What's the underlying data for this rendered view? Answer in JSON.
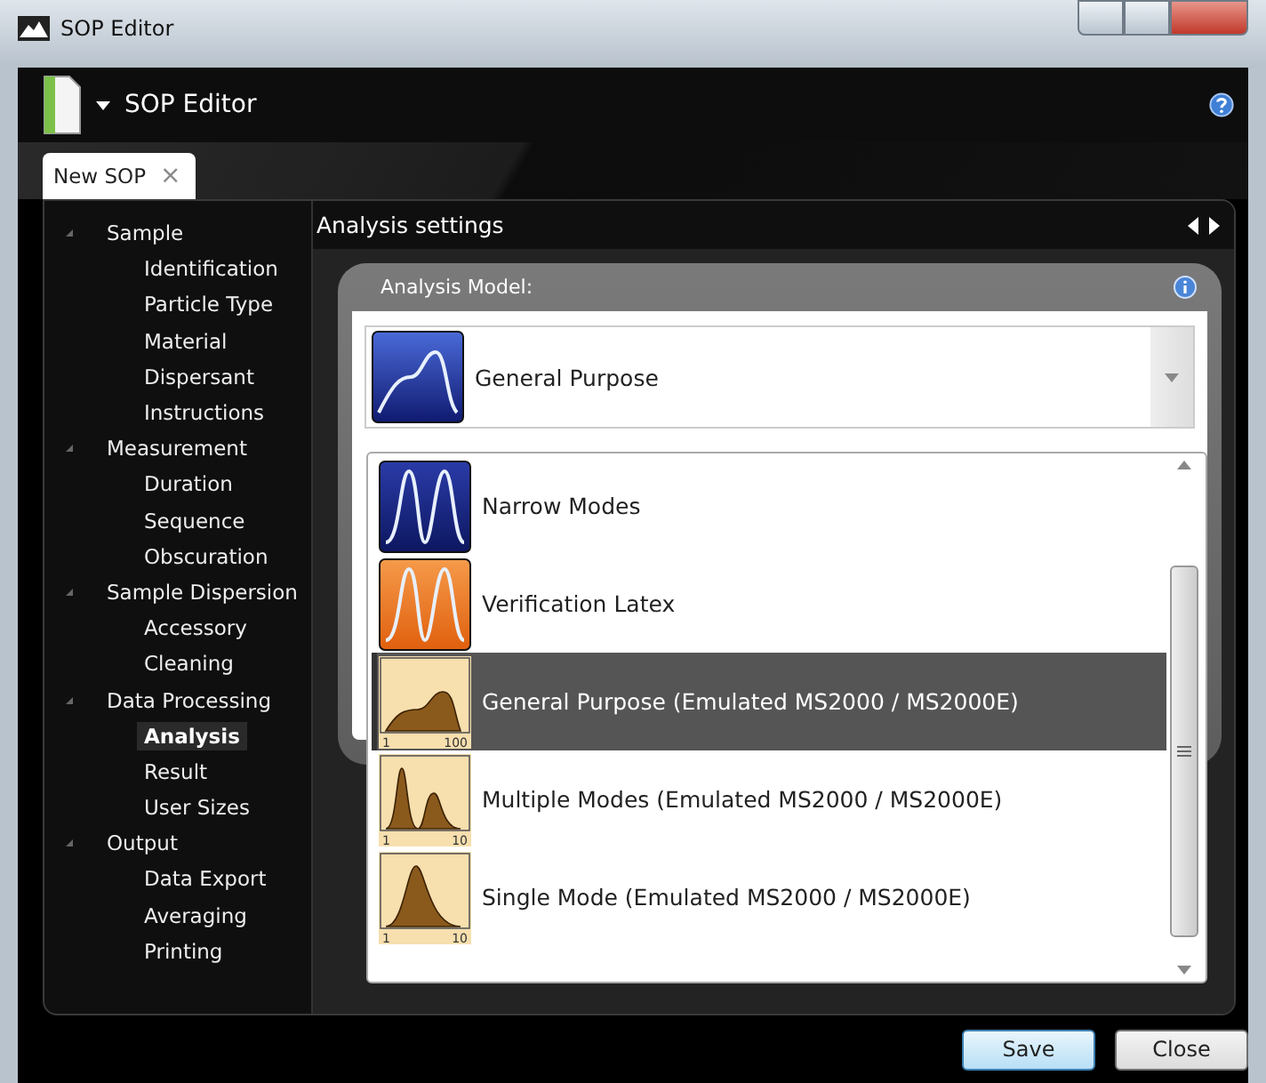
{
  "window": {
    "title": "SOP Editor"
  },
  "header": {
    "title": "SOP Editor"
  },
  "tabs": [
    {
      "label": "New SOP",
      "close": "×",
      "selected": true
    }
  ],
  "tree": [
    {
      "label": "Sample",
      "expanded": true,
      "children": [
        {
          "label": "Identification",
          "selected": false
        },
        {
          "label": "Particle Type",
          "selected": false
        },
        {
          "label": "Material",
          "selected": false
        },
        {
          "label": "Dispersant",
          "selected": false
        },
        {
          "label": "Instructions",
          "selected": false
        }
      ]
    },
    {
      "label": "Measurement",
      "expanded": true,
      "children": [
        {
          "label": "Duration",
          "selected": false
        },
        {
          "label": "Sequence",
          "selected": false
        },
        {
          "label": "Obscuration",
          "selected": false
        }
      ]
    },
    {
      "label": "Sample Dispersion",
      "expanded": true,
      "children": [
        {
          "label": "Accessory",
          "selected": false
        },
        {
          "label": "Cleaning",
          "selected": false
        }
      ]
    },
    {
      "label": "Data Processing",
      "expanded": true,
      "children": [
        {
          "label": "Analysis",
          "selected": true
        },
        {
          "label": "Result",
          "selected": false
        },
        {
          "label": "User Sizes",
          "selected": false
        }
      ]
    },
    {
      "label": "Output",
      "expanded": true,
      "children": [
        {
          "label": "Data Export",
          "selected": false
        },
        {
          "label": "Averaging",
          "selected": false
        },
        {
          "label": "Printing",
          "selected": false
        }
      ]
    }
  ],
  "section": {
    "title": "Analysis settings"
  },
  "analysis_model": {
    "label": "Analysis Model:",
    "value": {
      "label": "General Purpose",
      "kind": "general"
    },
    "options": [
      {
        "label": "Narrow Modes",
        "kind": "narrow",
        "selected": false
      },
      {
        "label": "Verification Latex",
        "kind": "latex",
        "selected": false
      },
      {
        "label": "General Purpose (Emulated MS2000 / MS2000E)",
        "kind": "histogram-broad",
        "axis_min": "1",
        "axis_max": "100",
        "selected": true
      },
      {
        "label": "Multiple Modes (Emulated MS2000 / MS2000E)",
        "kind": "histogram-multi",
        "axis_min": "1",
        "axis_max": "10",
        "selected": false
      },
      {
        "label": "Single Mode (Emulated MS2000 / MS2000E)",
        "kind": "histogram-single",
        "axis_min": "1",
        "axis_max": "10",
        "selected": false
      }
    ]
  },
  "buttons": [
    {
      "label": "Save",
      "kind": "primary"
    },
    {
      "label": "Close",
      "kind": "normal"
    }
  ]
}
